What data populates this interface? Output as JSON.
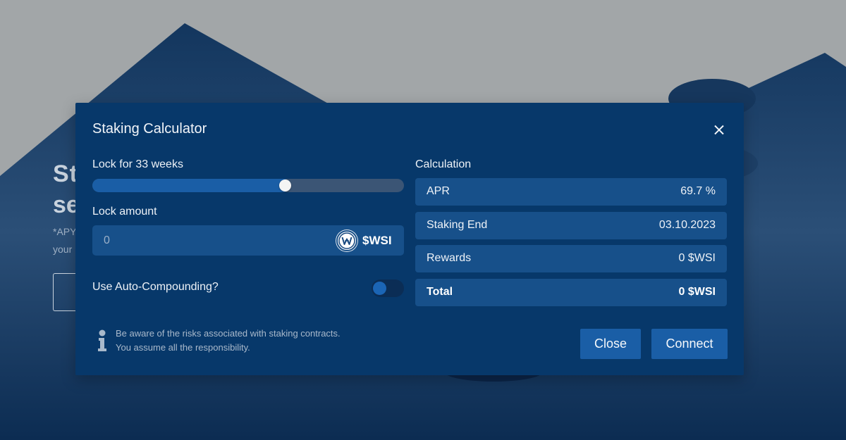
{
  "background": {
    "heading_line_1": "St",
    "heading_line_2": "se",
    "note_line_1": "*APY",
    "note_line_2": "your"
  },
  "modal": {
    "title": "Staking Calculator",
    "lock_label": "Lock for 33 weeks",
    "lock_slider_fraction": 0.62,
    "amount_label": "Lock amount",
    "amount_value": "",
    "amount_placeholder": "0",
    "token_symbol": "$WSI",
    "auto_compound_label": "Use Auto-Compounding?",
    "auto_compound_on": false,
    "info_line_1": "Be aware of the risks associated with staking contracts.",
    "info_line_2": "You assume all the responsibility.",
    "calculation_label": "Calculation",
    "calc_rows": [
      {
        "label": "APR",
        "value": "69.7 %"
      },
      {
        "label": "Staking End",
        "value": "03.10.2023"
      },
      {
        "label": "Rewards",
        "value": "0 $WSI"
      },
      {
        "label": "Total",
        "value": "0 $WSI"
      }
    ],
    "close_button": "Close",
    "connect_button": "Connect"
  },
  "colors": {
    "modal_bg": "#07386a",
    "row_bg": "#17508a",
    "accent": "#1a5ea6"
  }
}
